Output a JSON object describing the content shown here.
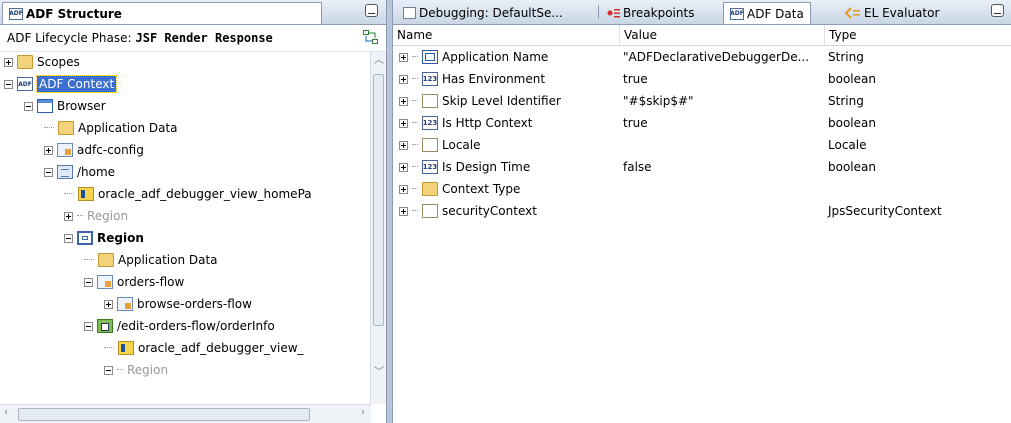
{
  "left_panel": {
    "tab_label": "ADF Structure",
    "phase_label": "ADF Lifecycle Phase:",
    "phase_value": "JSF Render Response",
    "tree": [
      {
        "label": "Scopes",
        "icon": "folder-icon",
        "depth": 0,
        "expander": "plus",
        "style": "normal"
      },
      {
        "label": "ADF Context",
        "icon": "adf-icon",
        "depth": 0,
        "expander": "minus",
        "style": "selected"
      },
      {
        "label": "Browser",
        "icon": "browser-icon",
        "depth": 1,
        "expander": "minus",
        "style": "normal"
      },
      {
        "label": "Application Data",
        "icon": "folder-icon",
        "depth": 2,
        "expander": "none",
        "style": "normal"
      },
      {
        "label": "adfc-config",
        "icon": "taskflow-icon",
        "depth": 2,
        "expander": "plus",
        "style": "normal"
      },
      {
        "label": "/home",
        "icon": "page-icon",
        "depth": 2,
        "expander": "minus",
        "style": "normal"
      },
      {
        "label": "oracle_adf_debugger_view_homePa",
        "icon": "jsp-icon",
        "depth": 3,
        "expander": "none",
        "style": "normal"
      },
      {
        "label": "Region",
        "icon": "none",
        "depth": 3,
        "expander": "plus",
        "style": "greyed"
      },
      {
        "label": "Region",
        "icon": "region-icon",
        "depth": 3,
        "expander": "minus",
        "style": "bold"
      },
      {
        "label": "Application Data",
        "icon": "folder-icon",
        "depth": 4,
        "expander": "none",
        "style": "normal"
      },
      {
        "label": "orders-flow",
        "icon": "taskflow-icon",
        "depth": 4,
        "expander": "minus",
        "style": "normal"
      },
      {
        "label": "browse-orders-flow",
        "icon": "taskflow-icon",
        "depth": 5,
        "expander": "plus",
        "style": "normal"
      },
      {
        "label": "/edit-orders-flow/orderInfo",
        "icon": "flowcall-icon",
        "depth": 4,
        "expander": "minus",
        "style": "normal"
      },
      {
        "label": "oracle_adf_debugger_view_",
        "icon": "jsp-icon",
        "depth": 5,
        "expander": "none",
        "style": "normal"
      },
      {
        "label": "Region",
        "icon": "none",
        "depth": 5,
        "expander": "minus",
        "style": "greyed"
      }
    ]
  },
  "right_panel": {
    "tabs": [
      {
        "label": "Debugging: DefaultSe...",
        "icon": "window-icon"
      },
      {
        "label": "Breakpoints",
        "icon": "breakpoints-icon"
      },
      {
        "label": "ADF Data",
        "icon": "adf-icon"
      },
      {
        "label": "EL Evaluator",
        "icon": "el-evaluator-icon"
      }
    ],
    "columns": {
      "name": "Name",
      "value": "Value",
      "type": "Type"
    },
    "rows": [
      {
        "name": "Application Name",
        "value": "\"ADFDeclarativeDebuggerDe...",
        "type": "String",
        "icon": "app-icon"
      },
      {
        "name": "Has Environment",
        "value": "true",
        "type": "boolean",
        "icon": "number-icon"
      },
      {
        "name": "Skip Level Identifier",
        "value": "\"#$skip$#\"",
        "type": "String",
        "icon": "field-icon"
      },
      {
        "name": "Is Http Context",
        "value": "true",
        "type": "boolean",
        "icon": "number-icon"
      },
      {
        "name": "Locale",
        "value": "",
        "type": "Locale",
        "icon": "field-icon"
      },
      {
        "name": "Is Design Time",
        "value": "false",
        "type": "boolean",
        "icon": "number-icon"
      },
      {
        "name": "Context Type",
        "value": "",
        "type": "",
        "icon": "folder-icon"
      },
      {
        "name": "securityContext",
        "value": "",
        "type": "JpsSecurityContext",
        "icon": "field-icon"
      }
    ]
  }
}
